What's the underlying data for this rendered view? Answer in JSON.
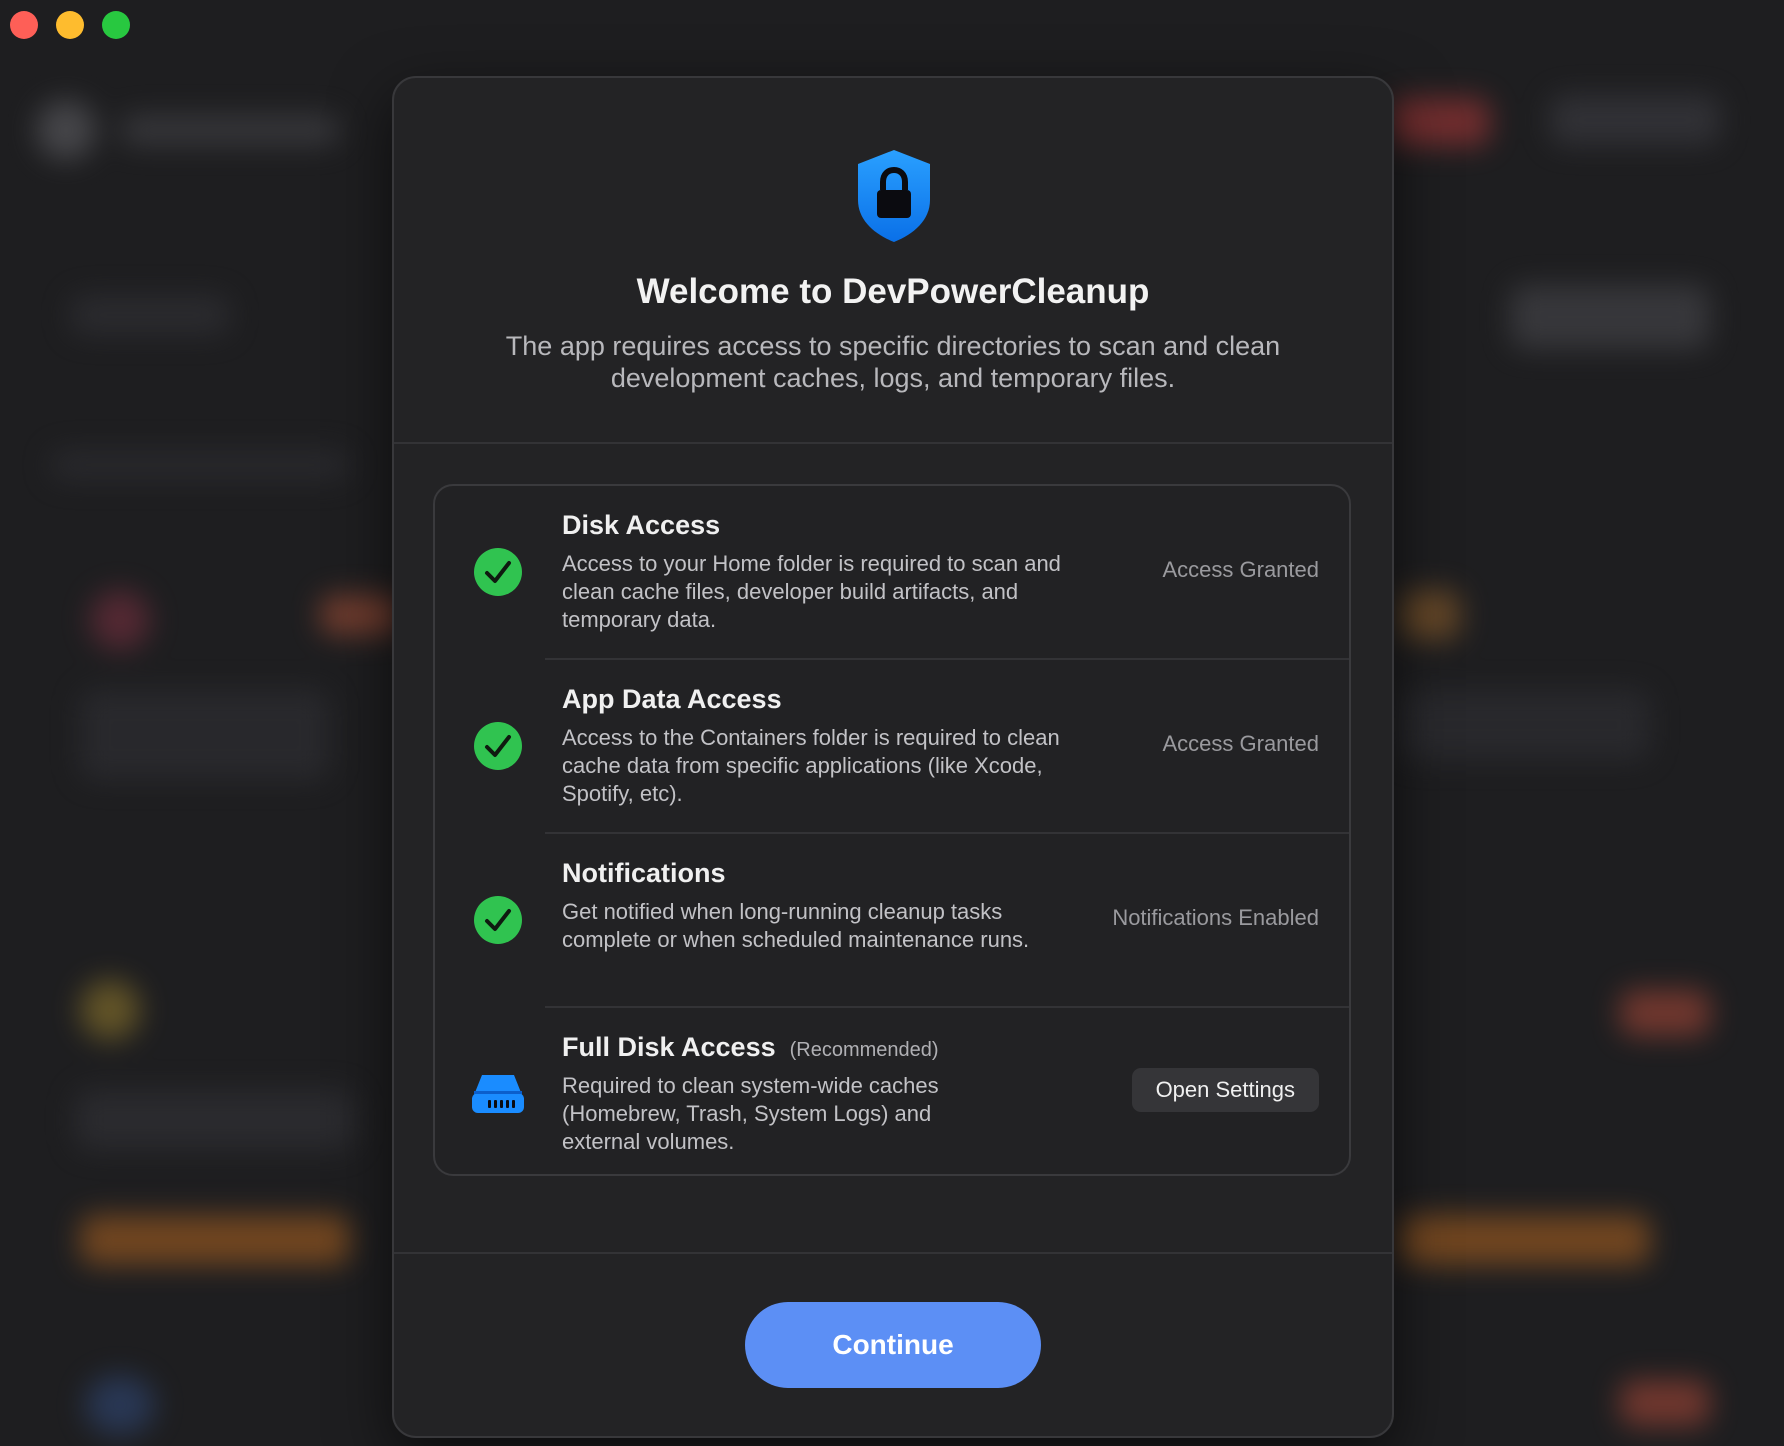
{
  "dialog": {
    "title": "Welcome to DevPowerCleanup",
    "subtitle": "The app requires access to specific directories to scan and clean development caches, logs, and temporary files.",
    "icon": "shield-lock-icon",
    "continue_label": "Continue"
  },
  "permissions": [
    {
      "title": "Disk Access",
      "description": "Access to your Home folder is required to scan and clean cache files, developer build artifacts, and temporary data.",
      "status": "Access Granted",
      "icon": "checkmark-circle-icon"
    },
    {
      "title": "App Data Access",
      "description": "Access to the Containers folder is required to clean cache data from specific applications (like Xcode, Spotify, etc).",
      "status": "Access Granted",
      "icon": "checkmark-circle-icon"
    },
    {
      "title": "Notifications",
      "description": "Get notified when long-running cleanup tasks complete or when scheduled maintenance runs.",
      "status": "Notifications Enabled",
      "icon": "checkmark-circle-icon"
    },
    {
      "title": "Full Disk Access",
      "tag": "(Recommended)",
      "description": "Required to clean system-wide caches (Homebrew, Trash, System Logs) and external volumes.",
      "button_label": "Open Settings",
      "icon": "hard-drive-icon"
    }
  ],
  "colors": {
    "accent": "#5c8ff5",
    "success": "#30c350",
    "shield": "#1a8cff"
  }
}
